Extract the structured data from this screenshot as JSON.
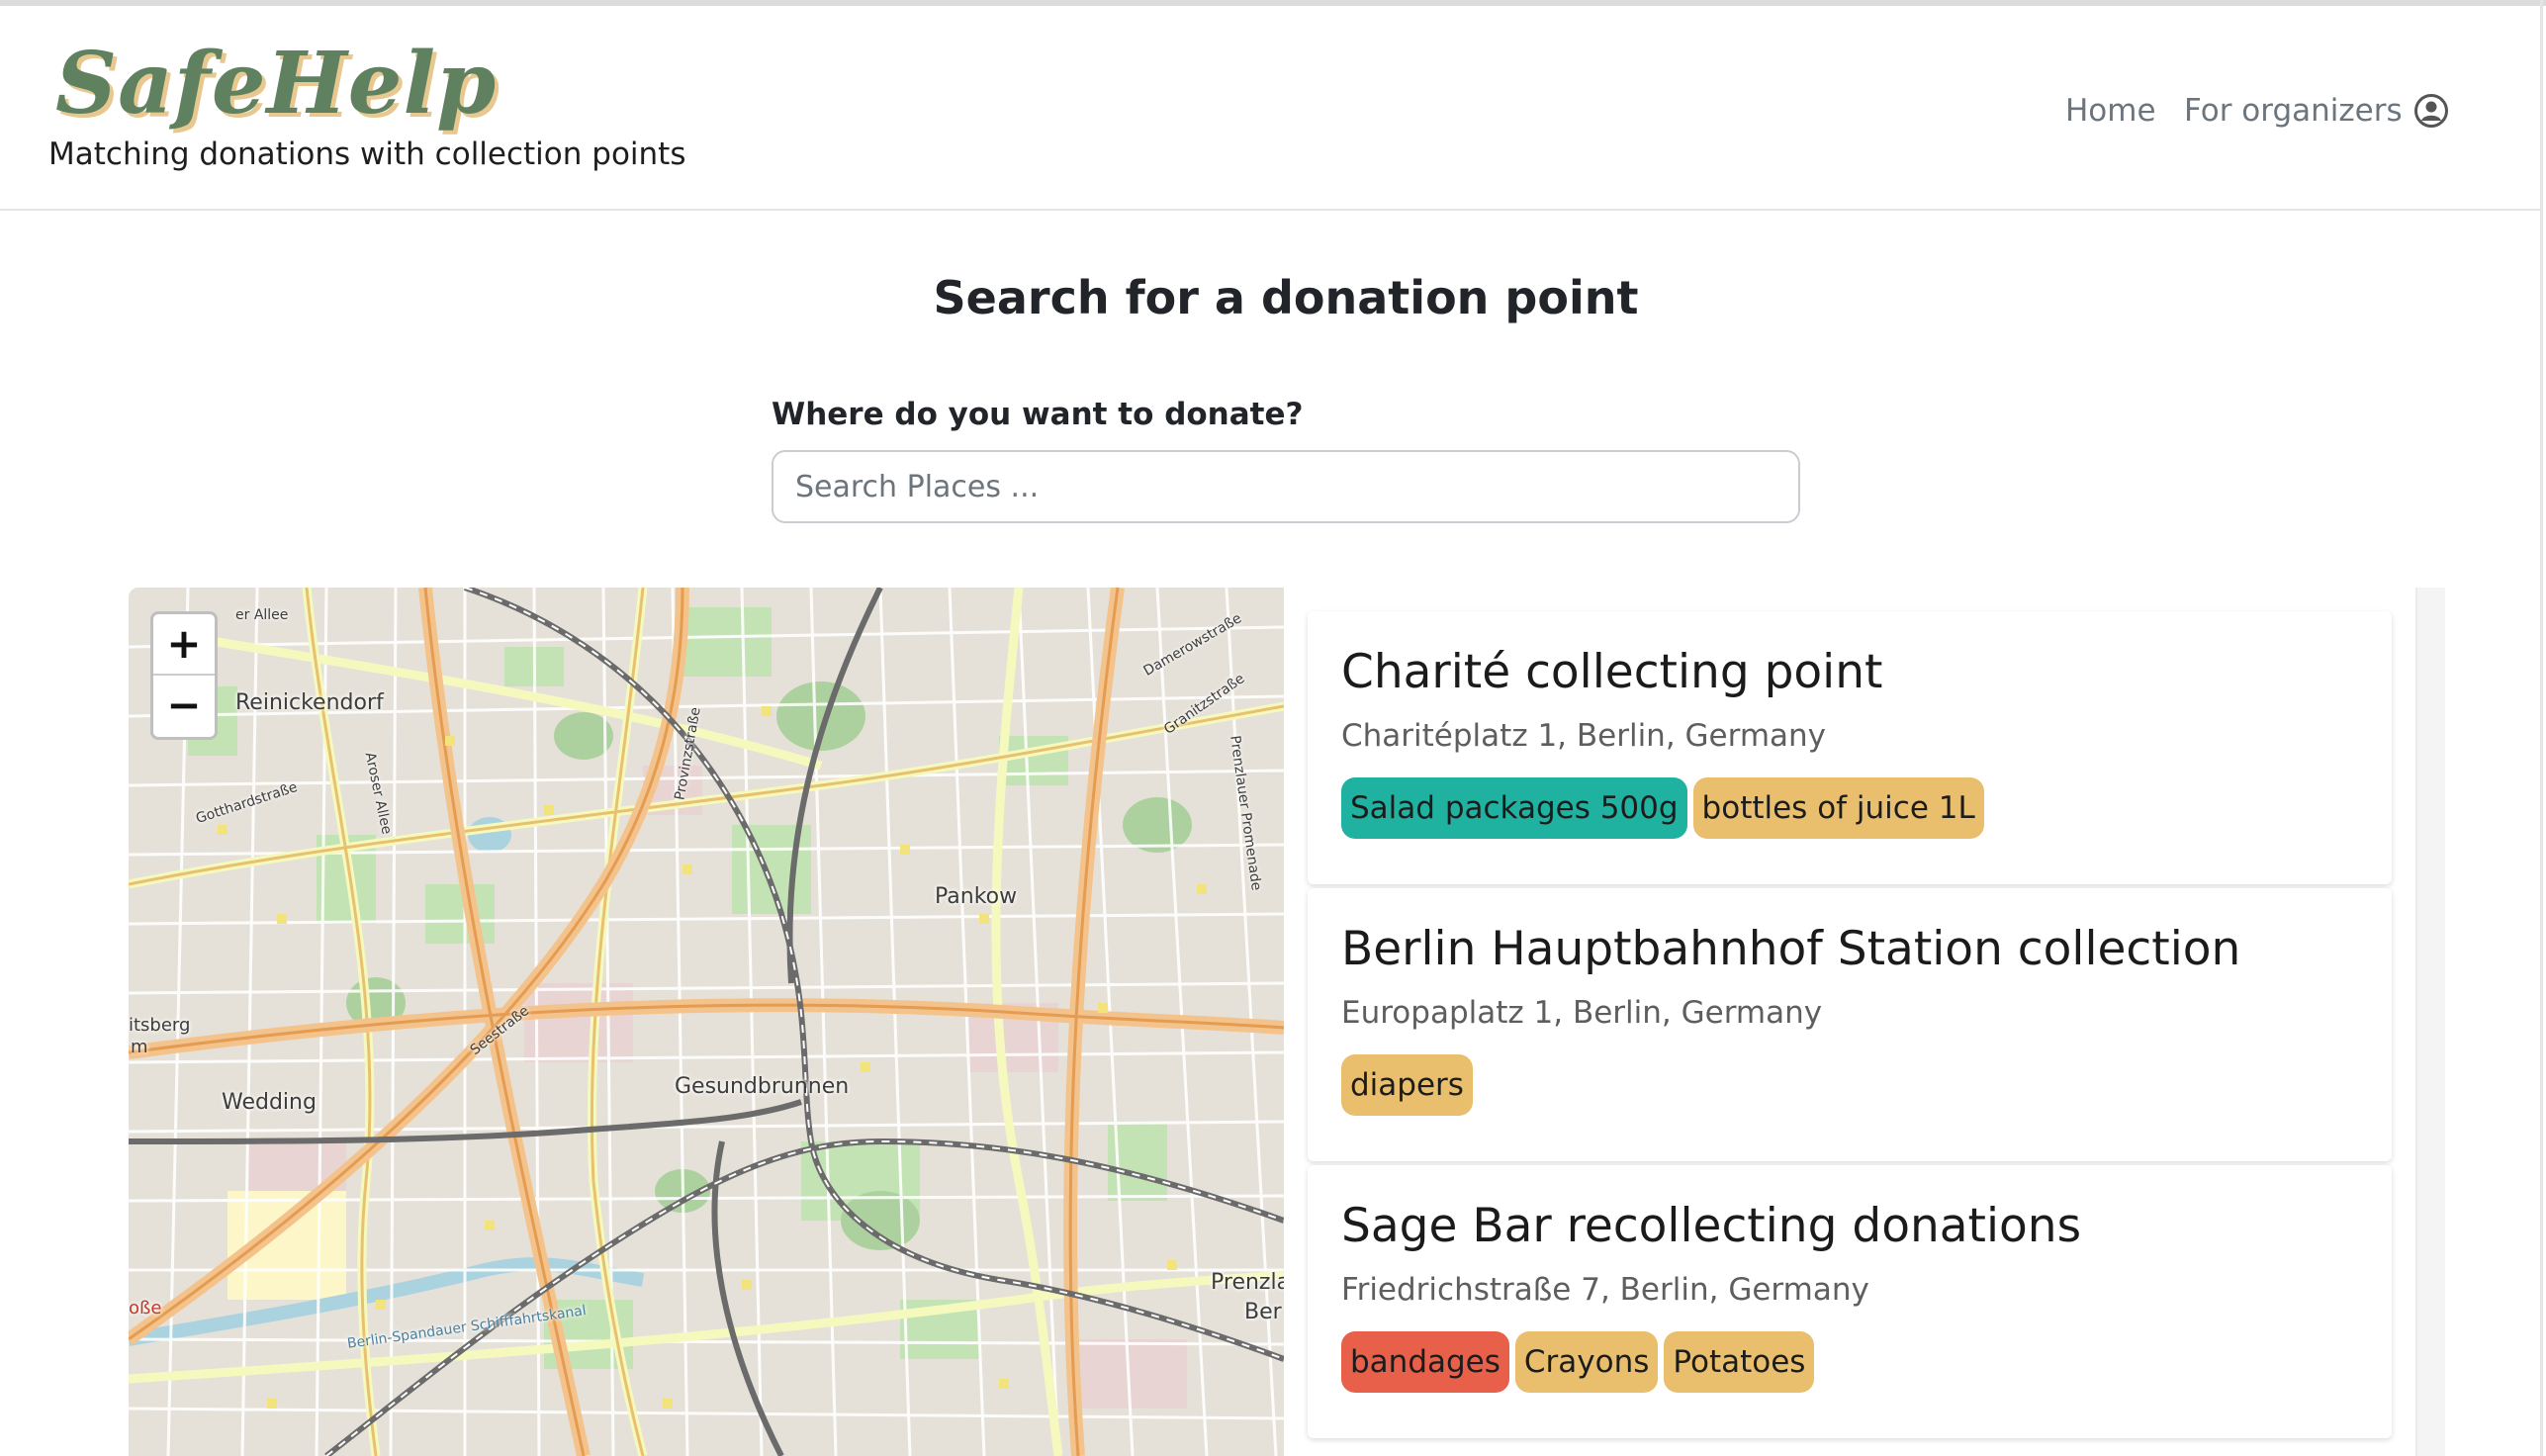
{
  "header": {
    "logo": "SafeHelp",
    "tagline": "Matching donations with collection points",
    "nav": {
      "home": "Home",
      "organizers": "For organizers"
    }
  },
  "main": {
    "title": "Search for a donation point",
    "search": {
      "label": "Where do you want to donate?",
      "placeholder": "Search Places ..."
    }
  },
  "map": {
    "zoom_in": "+",
    "zoom_out": "−",
    "labels": {
      "reinickendorf": "Reinickendorf",
      "pankow": "Pankow",
      "wedding": "Wedding",
      "gesundbrunnen": "Gesundbrunnen",
      "seestrasse": "Seestraße",
      "gotthardstrasse": "Gotthardstraße",
      "aroser_allee": "Aroser Allee",
      "provinzstrasse": "Provinzstraße",
      "prenzlauer_promenade": "Prenzlauer Promenade",
      "granitzstrasse": "Granitzstraße",
      "damerowstrasse": "Damerowstraße",
      "spandauer_kanal": "Berlin-Spandauer Schifffahrtskanal",
      "allee": "er Allee",
      "prenzl": "Prenzla",
      "ber": "Ber",
      "itsberg": "itsberg",
      "m": "m",
      "osse": "oße"
    }
  },
  "collection_points": [
    {
      "name": "Charité collecting point",
      "address": "Charitéplatz 1, Berlin, Germany",
      "tags": [
        {
          "label": "Salad packages 500g",
          "color": "#20b2a0"
        },
        {
          "label": "bottles of juice 1L",
          "color": "#e9bf6e"
        }
      ]
    },
    {
      "name": "Berlin Hauptbahnhof Station collection",
      "address": "Europaplatz 1, Berlin, Germany",
      "tags": [
        {
          "label": "diapers",
          "color": "#e9bf6e"
        }
      ]
    },
    {
      "name": "Sage Bar recollecting donations",
      "address": "Friedrichstraße 7, Berlin, Germany",
      "tags": [
        {
          "label": "bandages",
          "color": "#e8604a"
        },
        {
          "label": "Crayons",
          "color": "#e9bf6e"
        },
        {
          "label": "Potatoes",
          "color": "#e9bf6e"
        }
      ]
    }
  ],
  "colors": {
    "brand_green": "#5f8160",
    "brand_shadow": "#e8c88f",
    "nav_gray": "#6c757d"
  }
}
